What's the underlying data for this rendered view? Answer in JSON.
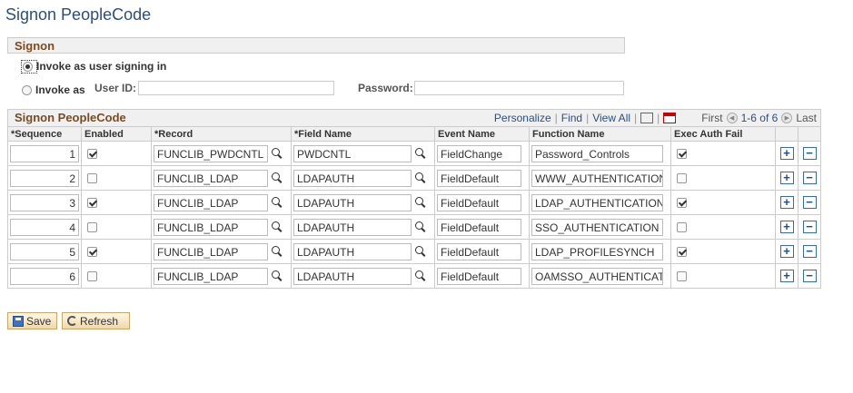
{
  "page": {
    "title": "Signon PeopleCode"
  },
  "signon_group": {
    "header": "Signon",
    "option_invoke_user": "Invoke as user signing in",
    "option_invoke_as": "Invoke as",
    "user_id_label": "User ID:",
    "user_id_value": "",
    "password_label": "Password:",
    "password_value": ""
  },
  "grid": {
    "title": "Signon PeopleCode",
    "nav": {
      "personalize": "Personalize",
      "find": "Find",
      "view_all": "View All",
      "first": "First",
      "range": "1-6 of 6",
      "last": "Last"
    },
    "columns": [
      "*Sequence",
      "Enabled",
      "*Record",
      "*Field Name",
      "Event Name",
      "Function Name",
      "Exec Auth Fail"
    ],
    "rows": [
      {
        "sequence": "1",
        "enabled": true,
        "record": "FUNCLIB_PWDCNTL",
        "field": "PWDCNTL",
        "event": "FieldChange",
        "function": "Password_Controls",
        "exec_auth_fail": true
      },
      {
        "sequence": "2",
        "enabled": false,
        "record": "FUNCLIB_LDAP",
        "field": "LDAPAUTH",
        "event": "FieldDefault",
        "function": "WWW_AUTHENTICATION",
        "exec_auth_fail": false
      },
      {
        "sequence": "3",
        "enabled": true,
        "record": "FUNCLIB_LDAP",
        "field": "LDAPAUTH",
        "event": "FieldDefault",
        "function": "LDAP_AUTHENTICATION",
        "exec_auth_fail": true
      },
      {
        "sequence": "4",
        "enabled": false,
        "record": "FUNCLIB_LDAP",
        "field": "LDAPAUTH",
        "event": "FieldDefault",
        "function": "SSO_AUTHENTICATION",
        "exec_auth_fail": false
      },
      {
        "sequence": "5",
        "enabled": true,
        "record": "FUNCLIB_LDAP",
        "field": "LDAPAUTH",
        "event": "FieldDefault",
        "function": "LDAP_PROFILESYNCH",
        "exec_auth_fail": true
      },
      {
        "sequence": "6",
        "enabled": false,
        "record": "FUNCLIB_LDAP",
        "field": "LDAPAUTH",
        "event": "FieldDefault",
        "function": "OAMSSO_AUTHENTICATIC",
        "exec_auth_fail": false
      }
    ]
  },
  "toolbar": {
    "save_label": "Save",
    "refresh_label": "Refresh"
  },
  "icons": {
    "lookup": "magnifier-icon",
    "add_row": "plus-icon",
    "delete_row": "minus-icon",
    "save": "floppy-disk-icon",
    "refresh": "refresh-icon",
    "zoom": "zoom-grid-icon",
    "excel": "download-excel-icon",
    "first": "chevron-left-icon",
    "last": "chevron-right-icon"
  },
  "colors": {
    "title": "#2b4f7e",
    "group_header_text": "#7a4b1f",
    "link": "#2b4f7e",
    "button_bg": "#f0d8a8"
  }
}
